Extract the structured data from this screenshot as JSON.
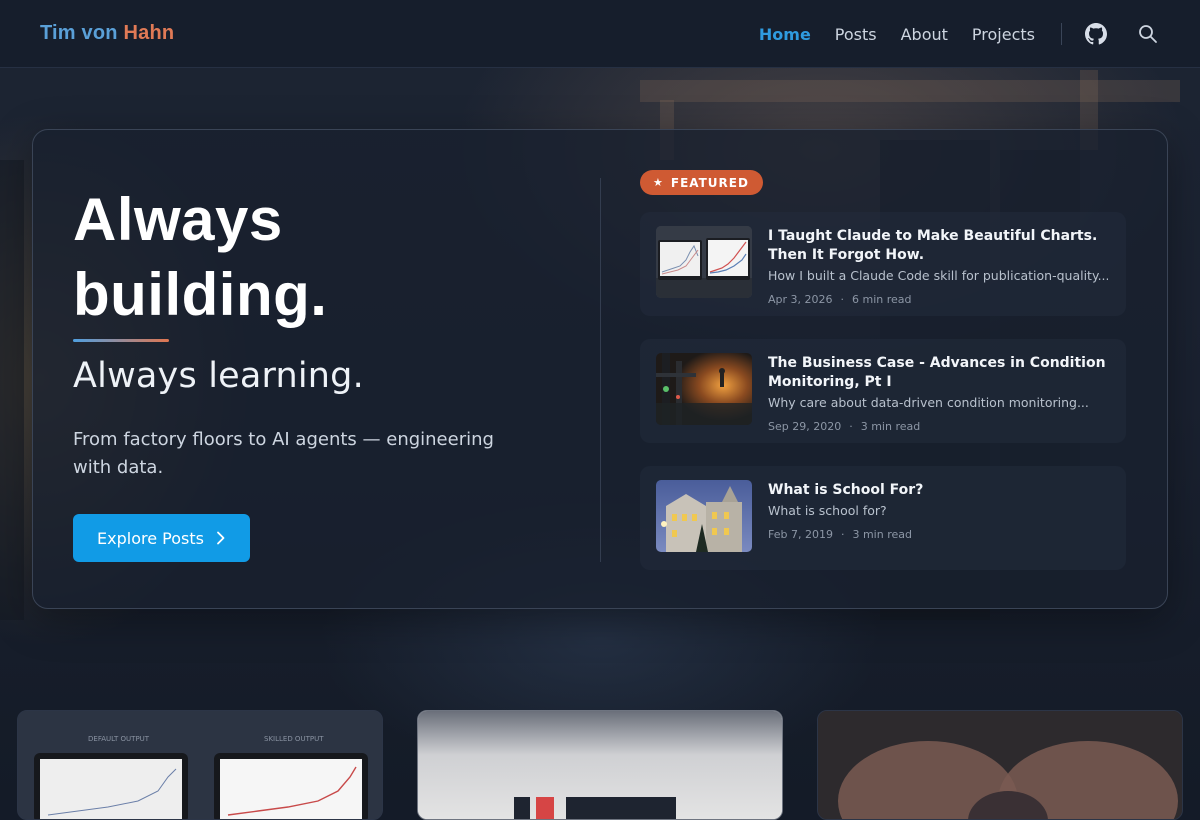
{
  "nav": {
    "brand_first": "Tim von",
    "brand_last": "Hahn",
    "links": [
      "Home",
      "Posts",
      "About",
      "Projects"
    ],
    "active": "Home",
    "icons": [
      "github-icon",
      "search-icon"
    ]
  },
  "hero": {
    "title_line1": "Always",
    "title_line2": "building.",
    "subtitle": "Always learning.",
    "description": "From factory floors to AI agents — engineering with data.",
    "cta_label": "Explore Posts",
    "featured_label": "FEATURED"
  },
  "posts": [
    {
      "title": "I Taught Claude to Make Beautiful Charts. Then It Forgot How.",
      "excerpt": "How I built a Claude Code skill for publication-quality...",
      "date": "Apr 3, 2026",
      "read_time": "6 min read"
    },
    {
      "title": "The Business Case - Advances in Condition Monitoring, Pt I",
      "excerpt": "Why care about data-driven condition monitoring...",
      "date": "Sep 29, 2020",
      "read_time": "3 min read"
    },
    {
      "title": "What is School For?",
      "excerpt": "What is school for?",
      "date": "Feb 7, 2019",
      "read_time": "3 min read"
    }
  ],
  "bottom_cards": {
    "card1_labels": [
      "DEFAULT OUTPUT",
      "SKILLED OUTPUT"
    ]
  },
  "colors": {
    "accent": "#119be6",
    "brand_blue": "#5aa0d8",
    "brand_orange": "#e07a56",
    "featured": "#cf5a33"
  }
}
